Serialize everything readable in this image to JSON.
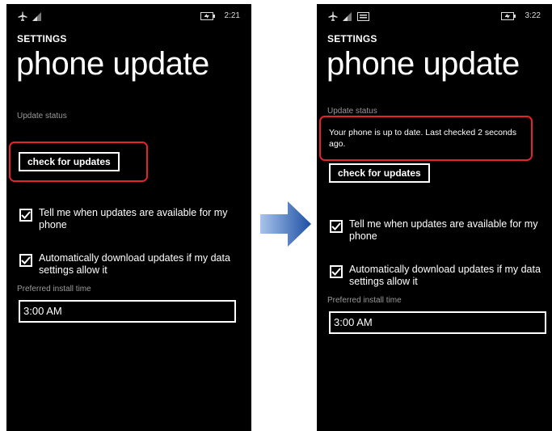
{
  "colors": {
    "highlight": "#e3242b",
    "arrow_dark": "#1c4fa3",
    "arrow_light": "#a9c4ec"
  },
  "icons": [
    "airplane-icon",
    "signal-icon",
    "battery-icon",
    "message-icon",
    "arrow-icon",
    "checkmark-icon"
  ],
  "left": {
    "status": {
      "time": "2:21"
    },
    "section_label": "SETTINGS",
    "title": "phone update",
    "update_status_label": "Update status",
    "check_button_label": "check for updates",
    "tell_me": {
      "checked": true,
      "label": "Tell me when updates are available for my phone"
    },
    "auto_download": {
      "checked": true,
      "label": "Automatically download updates if my data settings allow it"
    },
    "preferred_time_label": "Preferred install time",
    "preferred_time_value": "3:00 AM"
  },
  "right": {
    "status": {
      "time": "3:22"
    },
    "section_label": "SETTINGS",
    "title": "phone update",
    "update_status_label": "Update status",
    "status_message": "Your phone is up to date. Last checked 2 seconds ago.",
    "check_button_label": "check for updates",
    "tell_me": {
      "checked": true,
      "label": "Tell me when updates are available for my phone"
    },
    "auto_download": {
      "checked": true,
      "label": "Automatically download updates if my data settings allow it"
    },
    "preferred_time_label": "Preferred install time",
    "preferred_time_value": "3:00 AM"
  }
}
